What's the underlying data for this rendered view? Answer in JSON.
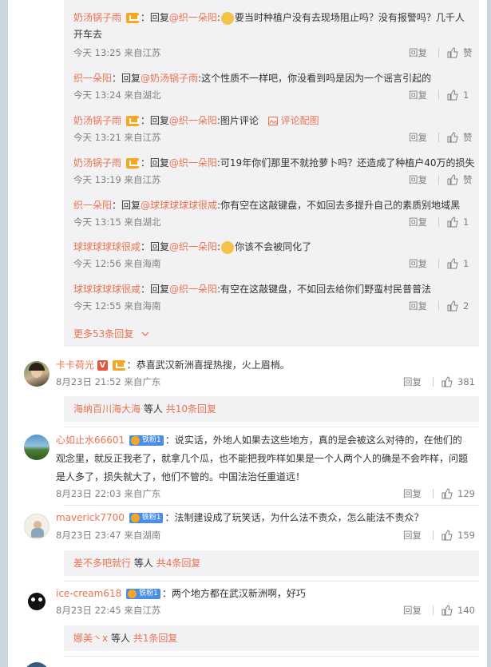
{
  "replies": [
    {
      "user": "奶汤锅子雨",
      "reply_to": "织一朵阳",
      "text": "要当时种植户没有去现场阻止吗？没有报警吗？几千人开车去",
      "time": "今天 13:25 来自江苏",
      "like": "赞"
    },
    {
      "user": "织一朵阳",
      "reply_to": "奶汤锅子雨",
      "text": "这个性质不一样吧，你没看到吗是因为一个谣言引起的",
      "time": "今天 13:24 来自湖北",
      "like": "1"
    },
    {
      "user": "奶汤锅子雨",
      "reply_to": "织一朵阳",
      "text": "图片评论",
      "pic_label": "评论配图",
      "time": "今天 13:21 来自江苏",
      "like": "赞"
    },
    {
      "user": "奶汤锅子雨",
      "reply_to": "织一朵阳",
      "text": "可19年你们那里不就抢萝卜吗？还造成了种植户40万的损失",
      "time": "今天 13:19 来自江苏",
      "like": "赞"
    },
    {
      "user": "织一朵阳",
      "reply_to": "球球球球球很咸",
      "text": "你有空在这敲键盘，不如回去多提升自己的素质别地域黑",
      "time": "今天 13:15 来自湖北",
      "like": "1"
    },
    {
      "user": "球球球球球很咸",
      "reply_to": "织一朵阳",
      "text": "你该不会被同化了",
      "time": "今天 12:56 来自海南",
      "like": "1"
    },
    {
      "user": "球球球球球很咸",
      "reply_to": "织一朵阳",
      "text": "有空在这敲键盘，不如回去给你们野蛮村民普普法",
      "time": "今天 12:55 来自海南",
      "like": "2"
    }
  ],
  "labels": {
    "reply": "回复",
    "reply_prefix": "：回复",
    "at": "@",
    "colon": ":",
    "colon2": "："
  },
  "more_replies": "更多53条回复",
  "comments": [
    {
      "user": "卡卡荷光",
      "text": "恭喜武汉新洲喜提热搜，火上眉梢。",
      "time": "8月23日 21:52 来自广东",
      "like": "381",
      "sub_user": "海纳百川海大海",
      "sub_text": "等人",
      "sub_count": "共10条回复"
    },
    {
      "user": "心如止水66601",
      "fans": "铁粉1",
      "text": "说实话，外地人如果去这些地方，真的是会被这么对待的，在他们的观念里，就反正我老了，就拿几个瓜，也不能把我咋样如果是一个人两个人的确是不会咋样，问题是人多了，损失就大了，他们不管的。中国法治任重道远！",
      "time": "8月23日 22:03 来自广东",
      "like": "129"
    },
    {
      "user": "maverick7700",
      "fans": "铁粉1",
      "text": "法制建设成了玩笑话，为什么法不责众，怎么能法不责众？",
      "time": "8月23日 23:47 来自湖南",
      "like": "159",
      "sub_user": "差不多吧就行",
      "sub_text": "等人",
      "sub_count": "共4条回复"
    },
    {
      "user": "ice-cream618",
      "fans": "铁粉1",
      "text": "两个地方都在武汉新洲啊，好巧",
      "time": "8月23日 22:45 来自江苏",
      "like": "140",
      "sub_user": "娜美丶x",
      "sub_text": "等人",
      "sub_count": "共1条回复"
    }
  ],
  "colors": {
    "accent": "#eb7350",
    "fans_badge": "#4a8ee8"
  }
}
